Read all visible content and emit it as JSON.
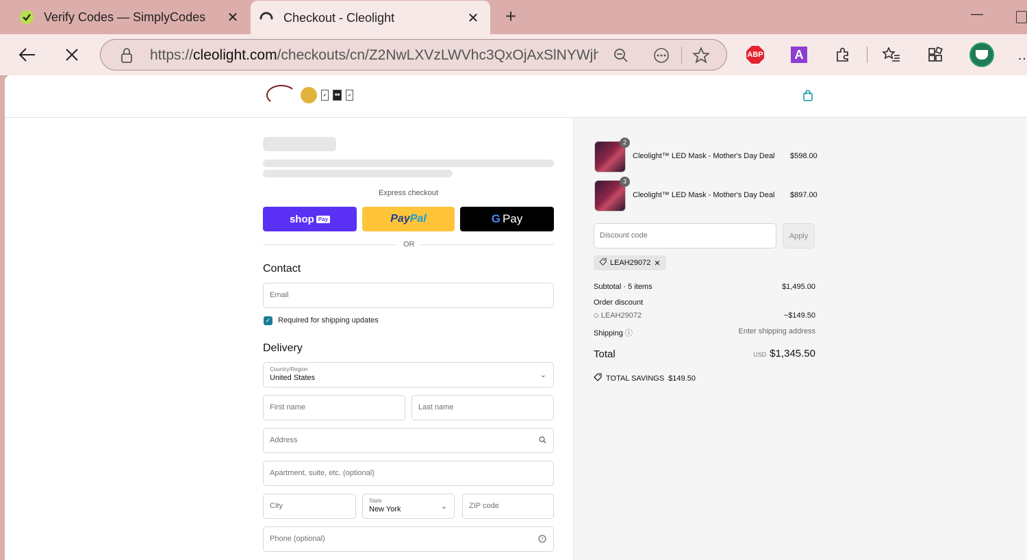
{
  "browser": {
    "tabs": [
      {
        "title": "Verify Codes — SimplyCodes",
        "favicon": "simplycodes-icon"
      },
      {
        "title": "Checkout - Cleolight",
        "favicon": "loading-icon"
      }
    ],
    "new_tab": "+",
    "url_prefix": "https://",
    "url_domain": "cleolight.com",
    "url_rest": "/checkouts/cn/Z2NwLXVzLWVhc3QxOjAxSlNYWjh...",
    "extensions": {
      "abp": "ABP",
      "a_ext": "A"
    }
  },
  "header": {
    "bag_icon": "shopping-bag-icon"
  },
  "checkout": {
    "express_label": "Express checkout",
    "shop_pay_label": "shop",
    "shop_pay_badge": "Pay",
    "paypal_label": "Pay",
    "paypal_label2": "Pal",
    "gpay_g": "G",
    "gpay_label": "Pay",
    "or_text": "OR",
    "contact_heading": "Contact",
    "email_placeholder": "Email",
    "shipping_updates_label": "Required for shipping updates",
    "delivery_heading": "Delivery",
    "country_label": "Country/Region",
    "country_value": "United States",
    "first_name_placeholder": "First name",
    "last_name_placeholder": "Last name",
    "address_placeholder": "Address",
    "apartment_placeholder": "Apartment, suite, etc. (optional)",
    "city_placeholder": "City",
    "state_label": "State",
    "state_value": "New York",
    "zip_placeholder": "ZIP code",
    "phone_placeholder": "Phone (optional)"
  },
  "summary": {
    "items": [
      {
        "qty": "2",
        "name": "Cleolight™ LED Mask - Mother's Day Deal",
        "price": "$598.00"
      },
      {
        "qty": "3",
        "name": "Cleolight™ LED Mask - Mother's Day Deal",
        "price": "$897.00"
      }
    ],
    "discount_placeholder": "Discount code",
    "apply_label": "Apply",
    "applied_code": "LEAH29072",
    "subtotal_label": "Subtotal · 5 items",
    "subtotal_value": "$1,495.00",
    "order_discount_label": "Order discount",
    "order_discount_code": "LEAH29072",
    "order_discount_value": "−$149.50",
    "shipping_label": "Shipping",
    "shipping_value": "Enter shipping address",
    "total_label": "Total",
    "total_currency": "USD",
    "total_value": "$1,345.50",
    "savings_label": "TOTAL SAVINGS",
    "savings_value": "$149.50"
  },
  "colors": {
    "chrome_bg": "#dcaeab",
    "toolbar_bg": "#f7e9e8",
    "shop_pay": "#5a31f4",
    "paypal": "#ffc43a",
    "gpay": "#000000",
    "accent_teal": "#1a7d96"
  }
}
